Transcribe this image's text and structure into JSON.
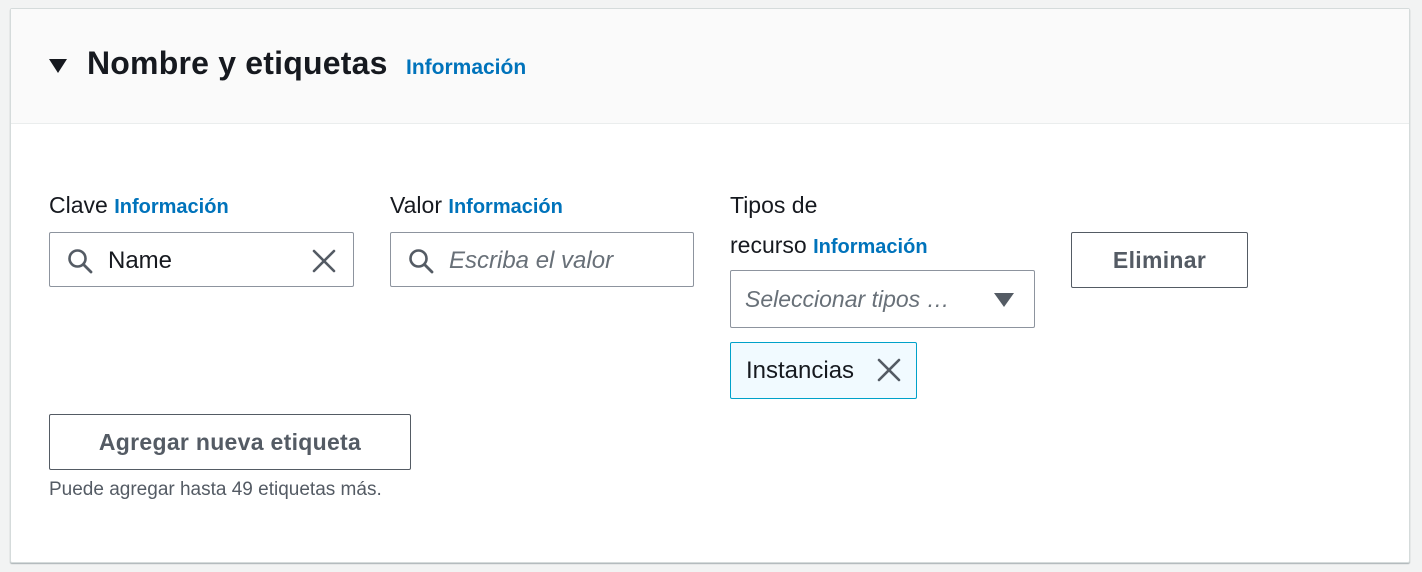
{
  "section": {
    "title": "Nombre y etiquetas",
    "info_link": "Información"
  },
  "fields": {
    "key": {
      "label": "Clave",
      "info_link": "Información",
      "value": "Name"
    },
    "value": {
      "label": "Valor",
      "info_link": "Información",
      "placeholder": "Escriba el valor"
    },
    "resource_types": {
      "label_line1": "Tipos de",
      "label_line2": "recurso",
      "info_link": "Información",
      "placeholder": "Seleccionar tipos …",
      "selected_tokens": [
        "Instancias"
      ]
    }
  },
  "buttons": {
    "remove": "Eliminar",
    "add_tag": "Agregar nueva etiqueta"
  },
  "hint": "Puede agregar hasta 49 etiquetas más.",
  "colors": {
    "link": "#0073bb",
    "token_bg": "#f1faff",
    "token_border": "#00a1c9",
    "text": "#16191f",
    "muted": "#687078"
  },
  "icons": {
    "collapse": "caret-down-icon",
    "search": "search-icon",
    "clear": "close-icon",
    "dropdown": "caret-down-icon",
    "token_remove": "close-icon"
  }
}
